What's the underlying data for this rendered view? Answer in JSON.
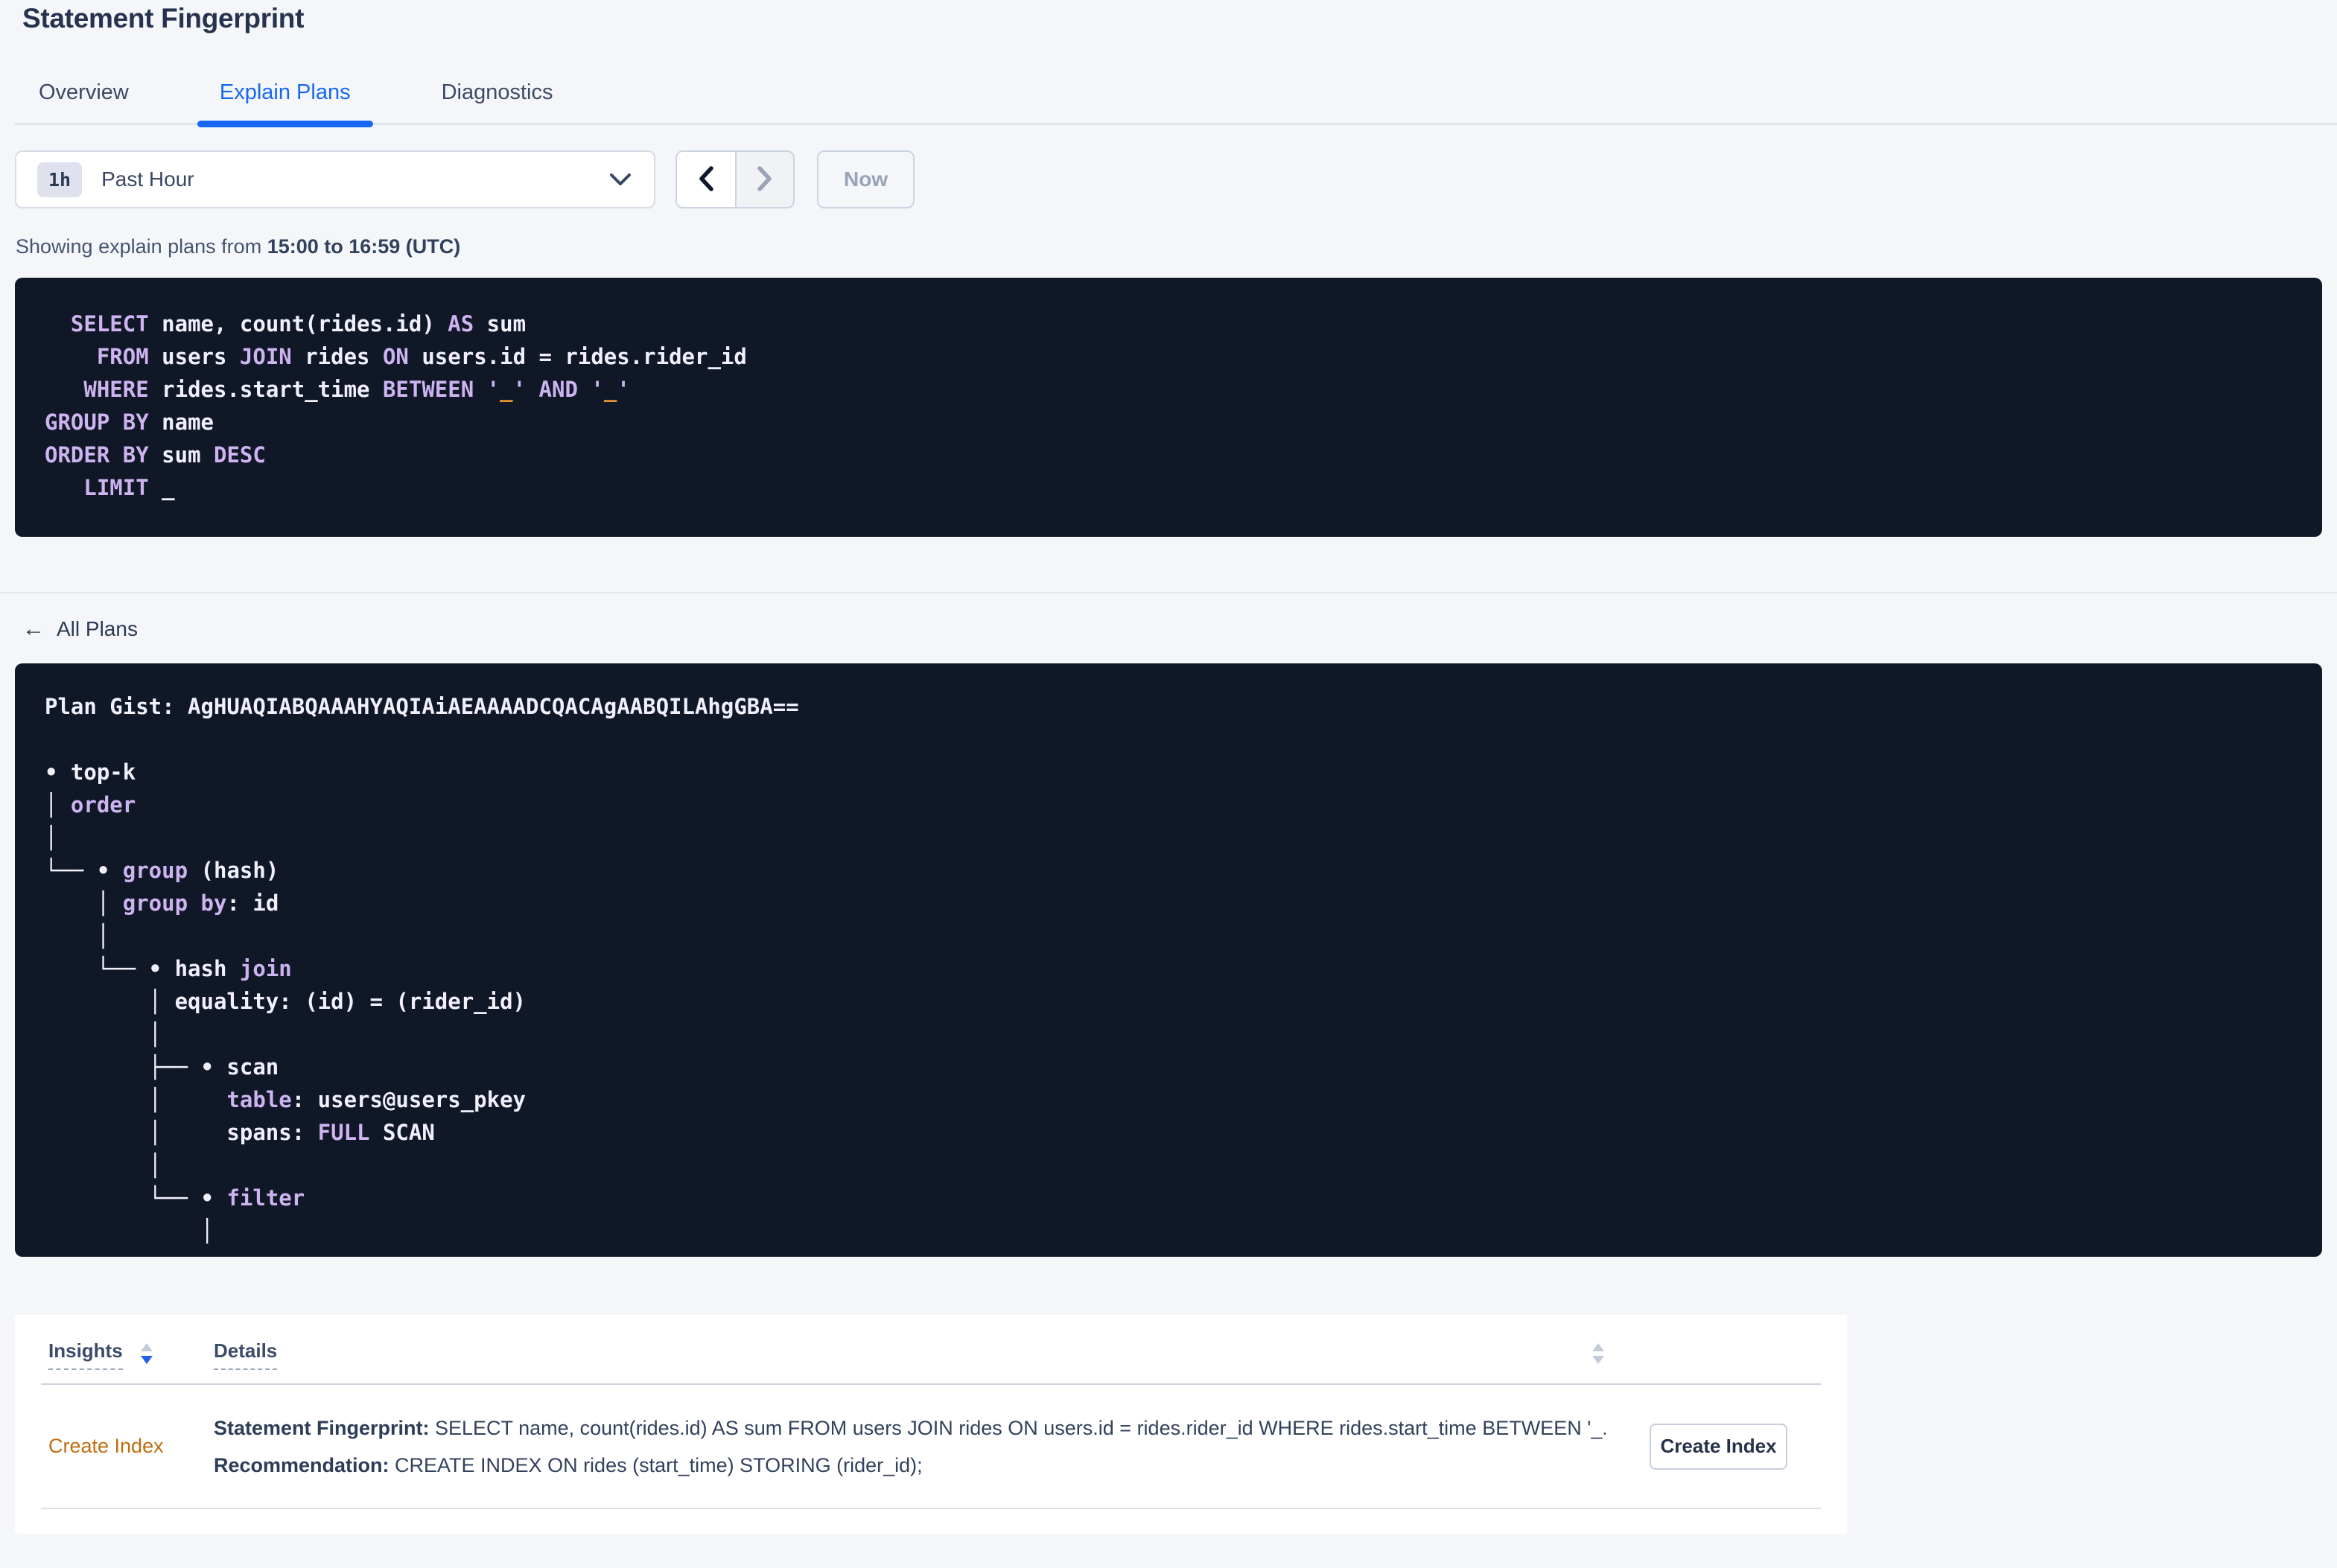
{
  "colors": {
    "page_background": "#f4f6fa",
    "accent_blue": "#1668f2",
    "code_background": "#101828",
    "code_keyword_lavender": "#cdb3ef",
    "code_literal_orange": "#ec9434",
    "insight_link_orange": "#bf6d0e",
    "sort_active_blue": "#2160e8"
  },
  "icons": {
    "back_arrow": "←"
  },
  "header": {
    "title": "Statement Fingerprint",
    "tabs": [
      {
        "label": "Overview",
        "active": false
      },
      {
        "label": "Explain Plans",
        "active": true
      },
      {
        "label": "Diagnostics",
        "active": false
      }
    ]
  },
  "toolbar": {
    "time_badge": "1h",
    "time_label": "Past Hour",
    "now_label": "Now",
    "showing_prefix": "Showing explain plans from ",
    "showing_range": "15:00 to 16:59 (UTC)"
  },
  "sql": {
    "lines": [
      [
        {
          "c": "kw",
          "t": "  SELECT"
        },
        {
          "c": "pl",
          "t": " name, count(rides.id) "
        },
        {
          "c": "kw",
          "t": "AS"
        },
        {
          "c": "pl",
          "t": " sum"
        }
      ],
      [
        {
          "c": "kw",
          "t": "    FROM"
        },
        {
          "c": "pl",
          "t": " users "
        },
        {
          "c": "kw",
          "t": "JOIN"
        },
        {
          "c": "pl",
          "t": " rides "
        },
        {
          "c": "kw",
          "t": "ON"
        },
        {
          "c": "pl",
          "t": " users.id = rides.rider_id"
        }
      ],
      [
        {
          "c": "kw",
          "t": "   WHERE"
        },
        {
          "c": "pl",
          "t": " rides.start_time "
        },
        {
          "c": "kw",
          "t": "BETWEEN"
        },
        {
          "c": "pl",
          "t": " "
        },
        {
          "c": "kw",
          "t": "'"
        },
        {
          "c": "lit",
          "t": "_"
        },
        {
          "c": "kw",
          "t": "'"
        },
        {
          "c": "pl",
          "t": " "
        },
        {
          "c": "kw",
          "t": "AND"
        },
        {
          "c": "pl",
          "t": " "
        },
        {
          "c": "kw",
          "t": "'"
        },
        {
          "c": "lit",
          "t": "_"
        },
        {
          "c": "kw",
          "t": "'"
        }
      ],
      [
        {
          "c": "kw",
          "t": "GROUP BY"
        },
        {
          "c": "pl",
          "t": " name"
        }
      ],
      [
        {
          "c": "kw",
          "t": "ORDER BY"
        },
        {
          "c": "pl",
          "t": " sum "
        },
        {
          "c": "kw",
          "t": "DESC"
        }
      ],
      [
        {
          "c": "kw",
          "t": "   LIMIT"
        },
        {
          "c": "pl",
          "t": " _"
        }
      ]
    ]
  },
  "plan_section": {
    "back_label": "All Plans",
    "lines": [
      [
        {
          "c": "pl",
          "t": "Plan Gist: AgHUAQIABQAAAHYAQIAiAEAAAADCQACAgAABQILAhgGBA=="
        }
      ],
      [],
      [
        {
          "c": "pl",
          "t": "• top-k"
        }
      ],
      [
        {
          "c": "pl",
          "t": "│ "
        },
        {
          "c": "kw",
          "t": "order"
        }
      ],
      [
        {
          "c": "pl",
          "t": "│"
        }
      ],
      [
        {
          "c": "pl",
          "t": "└── • "
        },
        {
          "c": "kw",
          "t": "group"
        },
        {
          "c": "pl",
          "t": " (hash)"
        }
      ],
      [
        {
          "c": "pl",
          "t": "    │ "
        },
        {
          "c": "kw",
          "t": "group by"
        },
        {
          "c": "pl",
          "t": ": id"
        }
      ],
      [
        {
          "c": "pl",
          "t": "    │"
        }
      ],
      [
        {
          "c": "pl",
          "t": "    └── • hash "
        },
        {
          "c": "kw",
          "t": "join"
        }
      ],
      [
        {
          "c": "pl",
          "t": "        │ equality: (id) = (rider_id)"
        }
      ],
      [
        {
          "c": "pl",
          "t": "        │"
        }
      ],
      [
        {
          "c": "pl",
          "t": "        ├── • scan"
        }
      ],
      [
        {
          "c": "pl",
          "t": "        │     "
        },
        {
          "c": "kw",
          "t": "table"
        },
        {
          "c": "pl",
          "t": ": users@users_pkey"
        }
      ],
      [
        {
          "c": "pl",
          "t": "        │     spans: "
        },
        {
          "c": "kw",
          "t": "FULL"
        },
        {
          "c": "pl",
          "t": " SCAN"
        }
      ],
      [
        {
          "c": "pl",
          "t": "        │"
        }
      ],
      [
        {
          "c": "pl",
          "t": "        └── • "
        },
        {
          "c": "kw",
          "t": "filter"
        }
      ],
      [
        {
          "c": "pl",
          "t": "            │"
        }
      ]
    ]
  },
  "insights_table": {
    "columns": [
      {
        "label": "Insights"
      },
      {
        "label": "Details"
      }
    ],
    "rows": [
      {
        "insight": "Create Index",
        "details": [
          {
            "label": "Statement Fingerprint:",
            "text": " SELECT name, count(rides.id) AS sum FROM users JOIN rides ON users.id = rides.rider_id WHERE rides.start_time BETWEEN '_..."
          },
          {
            "label": "Recommendation:",
            "text": " CREATE INDEX ON rides (start_time) STORING (rider_id);"
          }
        ],
        "action_label": "Create Index"
      }
    ]
  }
}
